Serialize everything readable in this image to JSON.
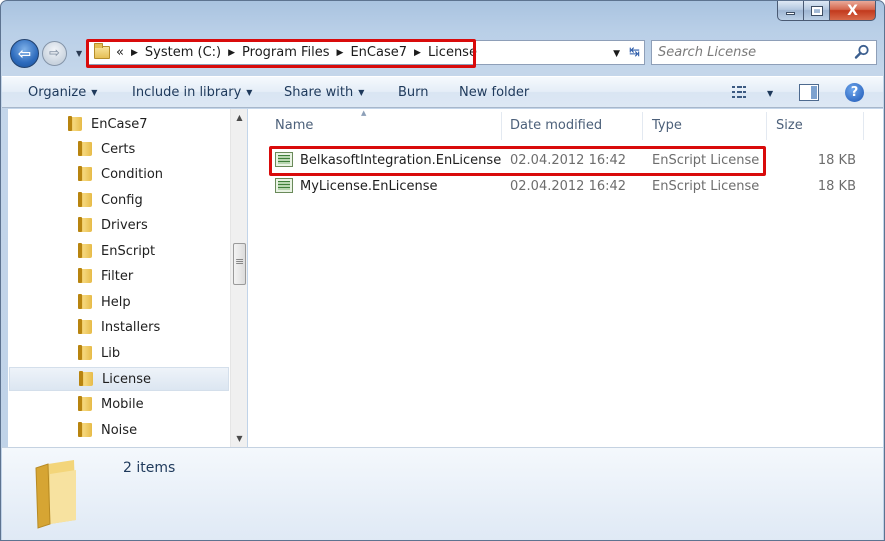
{
  "window": {
    "caption": {
      "minimize": "–",
      "close": "X"
    }
  },
  "navigation": {
    "breadcrumbs": [
      "«",
      "System (C:)",
      "Program Files",
      "EnCase7",
      "License"
    ],
    "search_placeholder": "Search License"
  },
  "toolbar": {
    "organize": "Organize",
    "include_in_library": "Include in library",
    "share_with": "Share with",
    "burn": "Burn",
    "new_folder": "New folder",
    "help": "?"
  },
  "tree": {
    "items": [
      {
        "label": "EnCase7",
        "selected": false
      },
      {
        "label": "Certs",
        "selected": false
      },
      {
        "label": "Condition",
        "selected": false
      },
      {
        "label": "Config",
        "selected": false
      },
      {
        "label": "Drivers",
        "selected": false
      },
      {
        "label": "EnScript",
        "selected": false
      },
      {
        "label": "Filter",
        "selected": false
      },
      {
        "label": "Help",
        "selected": false
      },
      {
        "label": "Installers",
        "selected": false
      },
      {
        "label": "Lib",
        "selected": false
      },
      {
        "label": "License",
        "selected": true
      },
      {
        "label": "Mobile",
        "selected": false
      },
      {
        "label": "Noise",
        "selected": false
      }
    ]
  },
  "file_list": {
    "columns": [
      "Name",
      "Date modified",
      "Type",
      "Size"
    ],
    "rows": [
      {
        "name": "BelkasoftIntegration.EnLicense",
        "date": "02.04.2012 16:42",
        "type": "EnScript License",
        "size": "18 KB"
      },
      {
        "name": "MyLicense.EnLicense",
        "date": "02.04.2012 16:42",
        "type": "EnScript License",
        "size": "18 KB"
      }
    ]
  },
  "details": {
    "item_count": "2 items"
  },
  "colors": {
    "highlight": "#d90b0b",
    "toolbar_text": "#1e395b",
    "accent": "#2d6bbd"
  }
}
